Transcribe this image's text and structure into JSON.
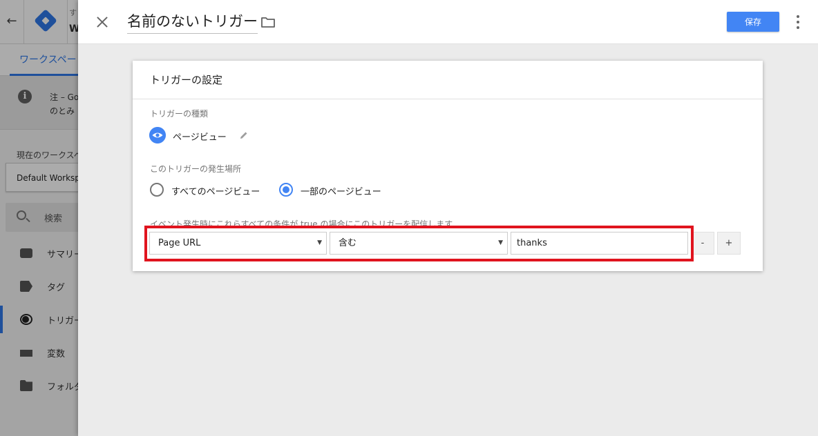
{
  "background": {
    "account_line1": "す",
    "account_line2": "W",
    "workspace_tab": "ワークスペー",
    "notice_line1": "注 – Go",
    "notice_line2": "のとみ",
    "current_workspace_label": "現在のワークスペ",
    "workspace_name": "Default Worksp",
    "search_label": "検索",
    "nav": [
      {
        "label": "サマリー"
      },
      {
        "label": "タグ"
      },
      {
        "label": "トリガー"
      },
      {
        "label": "変数"
      },
      {
        "label": "フォルダ"
      }
    ]
  },
  "header": {
    "trigger_name": "名前のないトリガー",
    "save_label": "保存"
  },
  "card": {
    "title": "トリガーの設定",
    "trigger_type_label": "トリガーの種類",
    "trigger_type": "ページビュー",
    "fire_on_label": "このトリガーの発生場所",
    "fire_options": [
      {
        "label": "すべてのページビュー",
        "selected": false
      },
      {
        "label": "一部のページビュー",
        "selected": true
      }
    ],
    "condition_label": "イベント発生時にこれらすべての条件が true の場合にこのトリガーを配信します",
    "condition": {
      "variable": "Page URL",
      "operator": "含む",
      "value": "thanks"
    },
    "remove_label": "-",
    "add_label": "+"
  },
  "colors": {
    "accent": "#4285f4",
    "highlight": "#e0141e"
  }
}
